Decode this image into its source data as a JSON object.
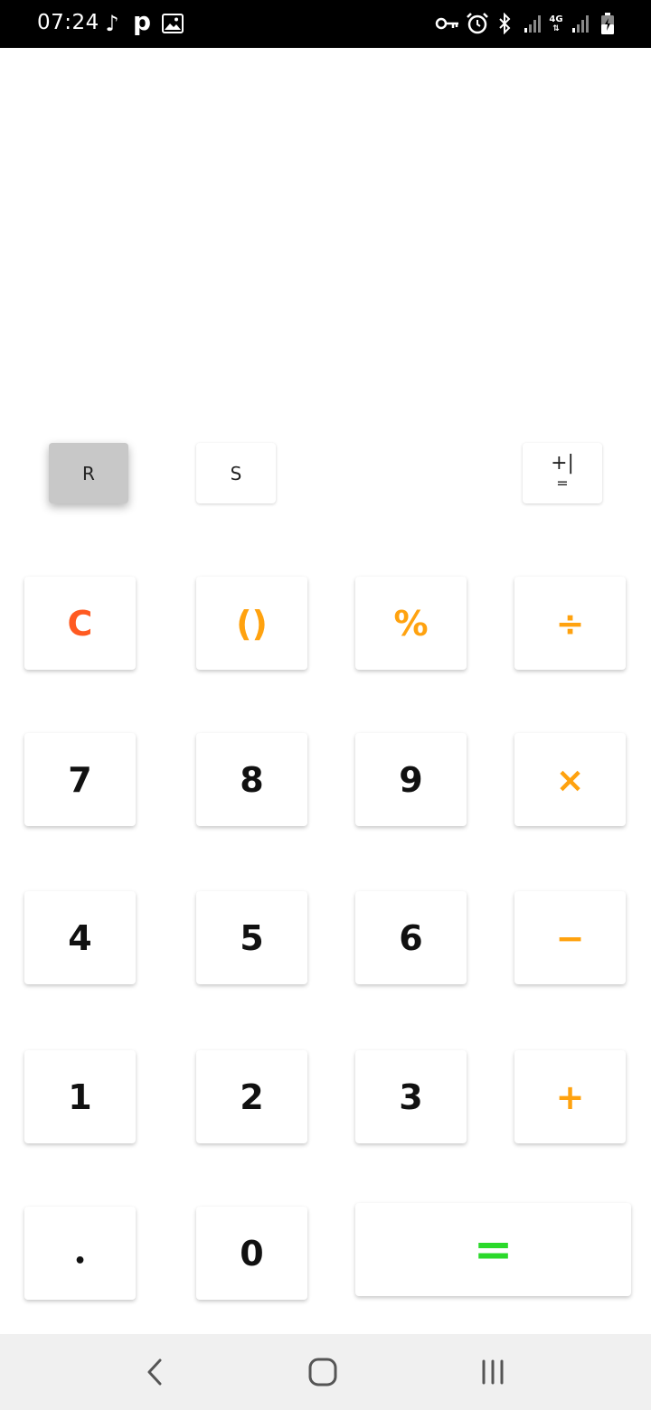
{
  "status_bar": {
    "time": "07:24",
    "icons": [
      "music-note-icon",
      "p-icon",
      "image-icon",
      "vpn-key-icon",
      "alarm-icon",
      "bluetooth-icon",
      "signal-icon",
      "4g-icon",
      "signal-icon",
      "battery-charging-icon"
    ],
    "network_label": "4G"
  },
  "function_buttons": {
    "r_label": "R",
    "s_label": "S",
    "plus_minus_top": "+|",
    "plus_minus_bottom": "="
  },
  "keypad": {
    "clear": "C",
    "parens": "()",
    "percent": "%",
    "divide": "÷",
    "seven": "7",
    "eight": "8",
    "nine": "9",
    "multiply": "×",
    "four": "4",
    "five": "5",
    "six": "6",
    "minus": "−",
    "one": "1",
    "two": "2",
    "three": "3",
    "plus": "+",
    "dot": "•",
    "zero": "0",
    "equals": "="
  },
  "colors": {
    "operator": "#ffa20f",
    "clear": "#ff5a21",
    "equals": "#2bd92b",
    "pressed_button": "#c8c8c8",
    "nav_bar": "#f0f0f0"
  },
  "nav_bar": {
    "icons": [
      "back-icon",
      "home-icon",
      "recent-apps-icon"
    ]
  }
}
